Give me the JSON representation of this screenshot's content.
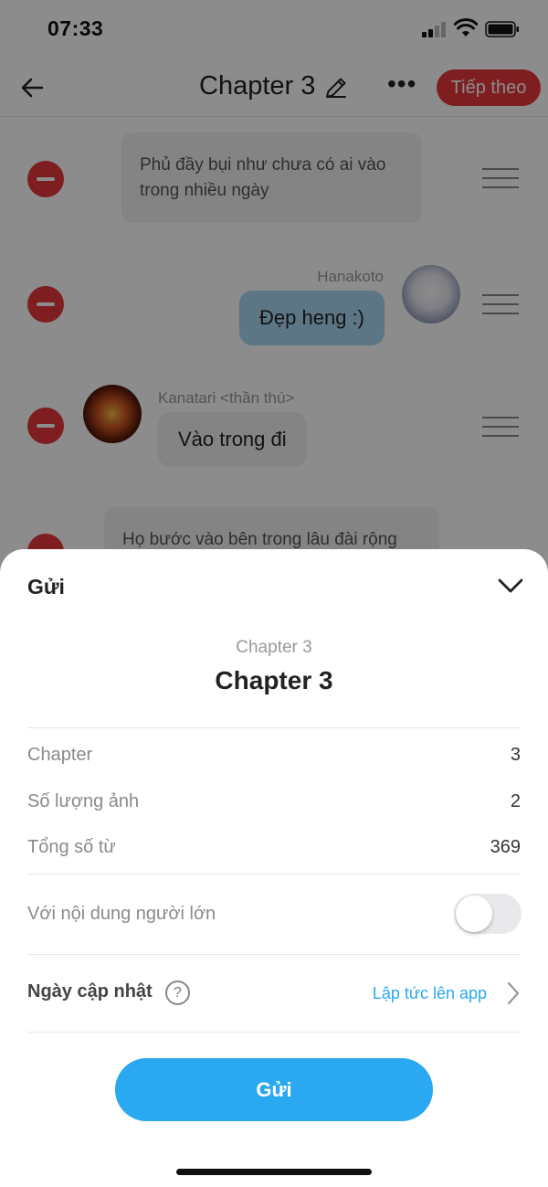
{
  "status_bar": {
    "time": "07:33"
  },
  "nav": {
    "title": "Chapter 3",
    "more": "•••",
    "next_label": "Tiếp theo"
  },
  "story": {
    "narration_1": "Phủ đầy bụi như chưa có ai vào trong nhiều ngày",
    "message_right": {
      "character": "Hanakoto",
      "text": "Đẹp heng :)"
    },
    "message_left": {
      "character": "Kanatari <thần thú>",
      "text": "Vào trong đi"
    },
    "narration_2": "Họ bước vào bên trong lâu đài rộng"
  },
  "sheet": {
    "title": "Gửi",
    "subtitle": "Chapter 3",
    "heading": "Chapter 3",
    "rows": [
      {
        "label": "Chapter",
        "value": "3"
      },
      {
        "label": "Số lượng ảnh",
        "value": "2"
      },
      {
        "label": "Tổng số từ",
        "value": "369"
      }
    ],
    "adult_label": "Với nội dung người lớn",
    "adult_enabled": false,
    "update_label": "Ngày cập nhật",
    "help": "?",
    "update_value": "Lập tức lên app",
    "send_label": "Gửi"
  },
  "colors": {
    "accent_red": "#e5383b",
    "accent_blue": "#2aa8f2",
    "link_blue": "#29a8f0",
    "bubble_blue": "#a9d8f5"
  }
}
